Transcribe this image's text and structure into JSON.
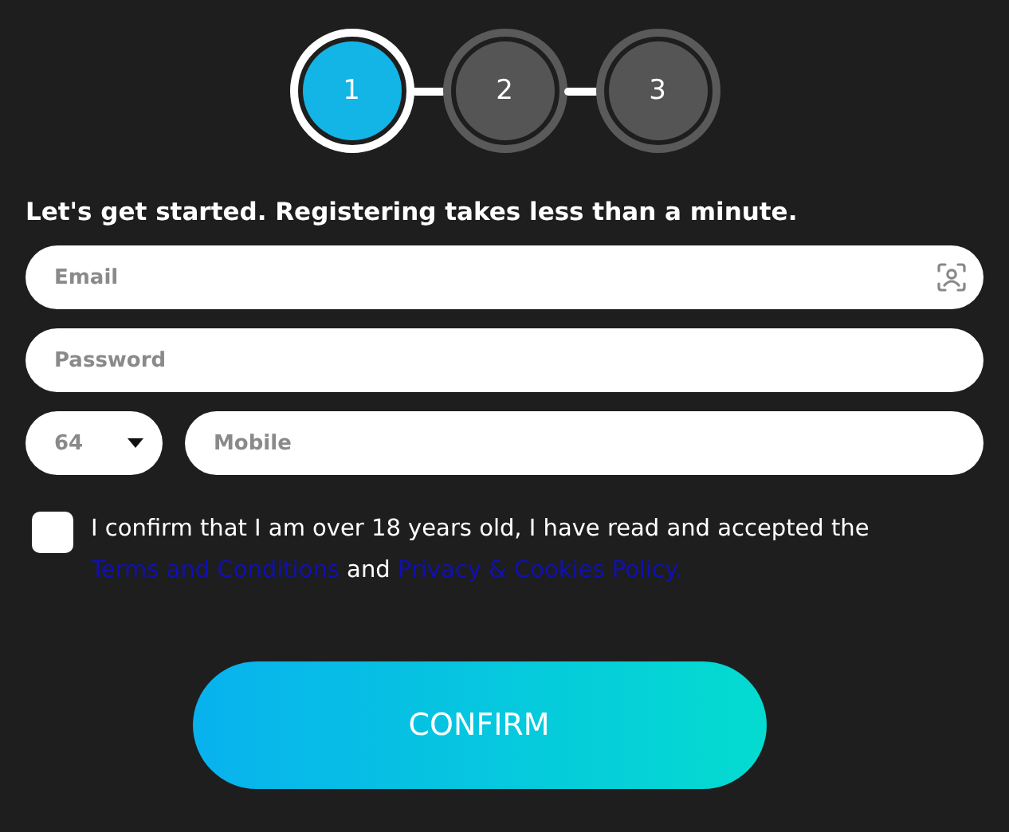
{
  "steps": [
    {
      "label": "1",
      "selected": true
    },
    {
      "label": "2",
      "selected": false
    },
    {
      "label": "3",
      "selected": false
    }
  ],
  "heading": "Let's get started. Registering takes less than a minute.",
  "fields": [
    {
      "kind": "email",
      "placeholder": "Email"
    },
    {
      "kind": "password",
      "placeholder": "Password"
    }
  ],
  "country_code": {
    "value": "64"
  },
  "mobile": {
    "placeholder": "Mobile"
  },
  "consent": {
    "checked": false,
    "parts": [
      {
        "kind": "text",
        "text": "I confirm that I am over 18 years old, I have read and accepted the "
      },
      {
        "kind": "link",
        "text": "Terms and Conditions"
      },
      {
        "kind": "text",
        "text": " and "
      },
      {
        "kind": "link",
        "text": "Privacy & Cookies Policy."
      }
    ]
  },
  "confirm_button": "CONFIRM"
}
